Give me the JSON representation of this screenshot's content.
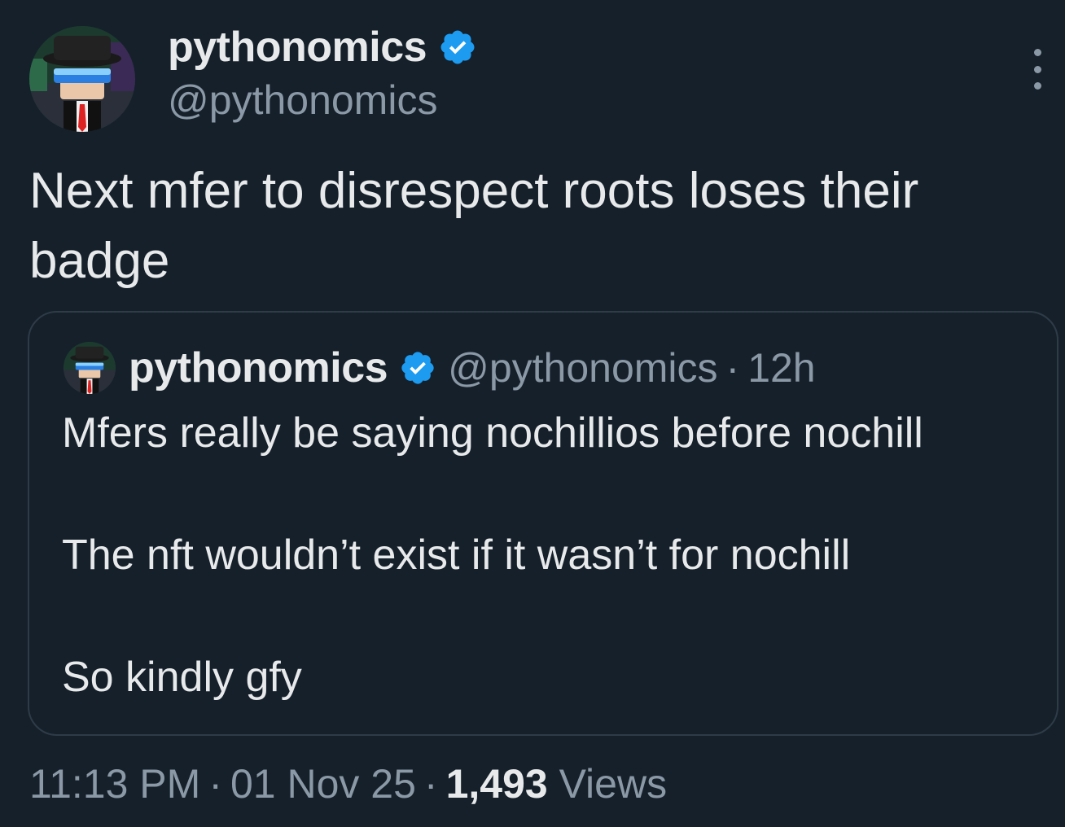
{
  "author": {
    "display_name": "pythonomics",
    "handle": "@pythonomics",
    "verified_icon": "verified-badge-icon",
    "avatar_icon": "avatar"
  },
  "more_menu_icon": "more-vertical-icon",
  "tweet": {
    "text": "Next mfer to disrespect roots loses their badge"
  },
  "quoted_tweet": {
    "display_name": "pythonomics",
    "handle": "@pythonomics",
    "separator": "·",
    "time": "12h",
    "lines": [
      "Mfers really be saying nochillios before nochill",
      "The nft wouldn’t exist if it wasn’t for nochill",
      "So kindly gfy"
    ]
  },
  "meta": {
    "time": "11:13 PM",
    "date": "01 Nov 25",
    "separator": "·",
    "views_count": "1,493",
    "views_label": "Views"
  },
  "colors": {
    "background": "#15202b",
    "text": "#e7e9ea",
    "secondary_text": "#8b98a5",
    "verified": "#1d9bf0",
    "border": "#2f3b47"
  }
}
